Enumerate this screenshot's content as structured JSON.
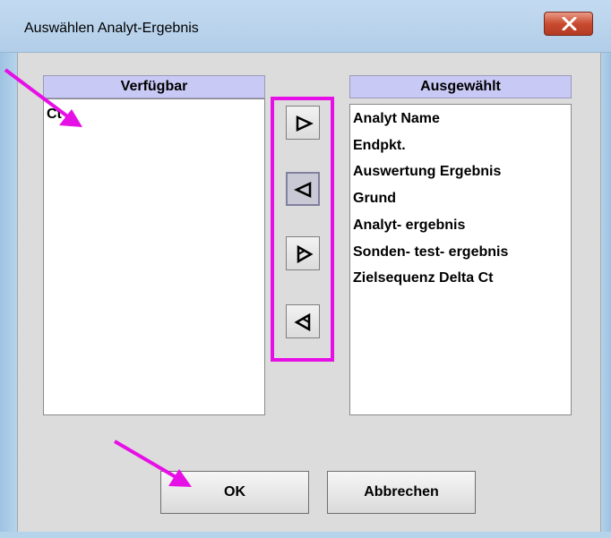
{
  "window": {
    "title": "Auswählen Analyt-Ergebnis",
    "close_glyph": "✕"
  },
  "available": {
    "header": "Verfügbar",
    "items": [
      "Ct"
    ]
  },
  "selected": {
    "header": "Ausgewählt",
    "items": [
      "Analyt Name",
      "Endpkt.",
      "Auswertung Ergebnis",
      "Grund",
      "Analyt- ergebnis",
      "Sonden- test- ergebnis",
      "Zielsequenz Delta Ct"
    ]
  },
  "transfer_buttons": [
    {
      "icon": "triangle-right-icon"
    },
    {
      "icon": "triangle-left-icon"
    },
    {
      "icon": "double-triangle-right-icon"
    },
    {
      "icon": "double-triangle-left-icon"
    }
  ],
  "buttons": {
    "ok": "OK",
    "cancel": "Abbrechen"
  },
  "colors": {
    "annotation": "#e60fe6",
    "list_header_bg": "#c9c9f6"
  }
}
